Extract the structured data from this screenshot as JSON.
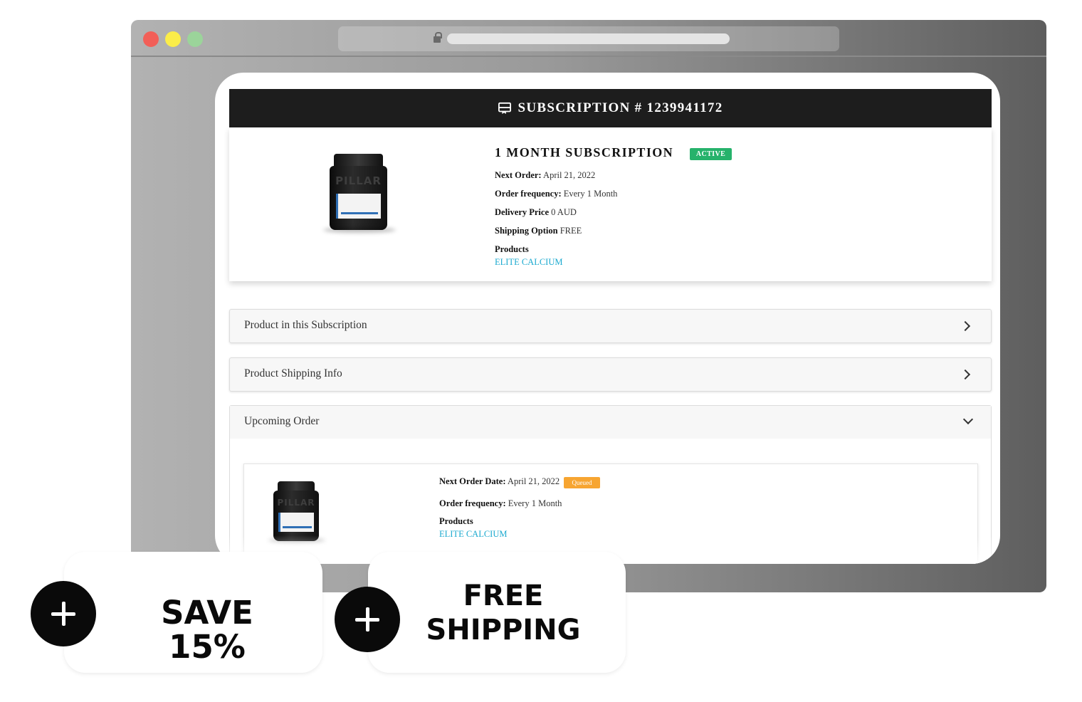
{
  "browser": {
    "traffic_lights": [
      "close",
      "minimize",
      "maximize"
    ],
    "colors": {
      "close": "#f25f58",
      "minimize": "#fbed49",
      "maximize": "#9bd49a"
    }
  },
  "subscription": {
    "header_title": "SUBSCRIPTION # 1239941172",
    "plan_title": "1 MONTH SUBSCRIPTION",
    "status": "ACTIVE",
    "next_order_label": "Next Order:",
    "next_order_value": " April 21, 2022",
    "frequency_label": "Order frequency:",
    "frequency_value": " Every 1 Month",
    "delivery_label": "Delivery Price",
    "delivery_value": " 0 AUD",
    "shipping_label": "Shipping Option",
    "shipping_value": " FREE",
    "products_label": "Products",
    "product_name": "ELITE CALCIUM",
    "jar_brand": "PILLAR"
  },
  "accordions": [
    {
      "title": "Product in this Subscription",
      "state": "collapsed"
    },
    {
      "title": "Product Shipping Info",
      "state": "collapsed"
    },
    {
      "title": "Upcoming Order",
      "state": "expanded"
    }
  ],
  "upcoming_order": {
    "next_date_label": "Next Order Date:",
    "next_date_value": " April 21, 2022",
    "status": "Queued",
    "frequency_label": "Order frequency:",
    "frequency_value": " Every 1 Month",
    "products_label": "Products",
    "product_name": "ELITE CALCIUM"
  },
  "promos": [
    {
      "label": "SAVE 15%",
      "icon": "plus-icon"
    },
    {
      "line1": "FREE",
      "line2": "SHIPPING",
      "icon": "plus-icon"
    }
  ],
  "colors": {
    "header_bg": "#1d1d1d",
    "active_badge": "#26b26b",
    "queued_badge": "#f7a531",
    "link": "#1aa9cf"
  }
}
